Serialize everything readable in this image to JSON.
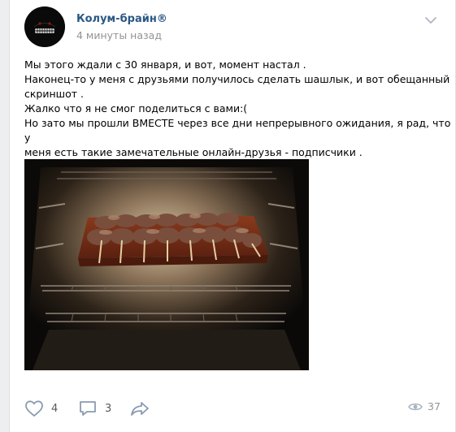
{
  "post": {
    "author": "Колум-брайн®",
    "time": "4 минуты назад",
    "text_lines": [
      "Мы этого ждали с 30 января, и вот, момент настал .",
      "Наконец-то у меня с друзьями получилось сделать шашлык, и вот обещанный",
      "скриншот .",
      "Жалко что я не смог поделиться с вами:(",
      "Но зато мы прошли ВМЕСТЕ через все дни непрерывного ожидания, я рад, что у",
      "меня есть такие замечательные онлайн-друзья - подписчики ."
    ]
  },
  "actions": {
    "likes": "4",
    "comments": "3",
    "views": "37"
  },
  "icons": {
    "like": "heart-icon",
    "comment": "comment-icon",
    "share": "share-arrow-icon",
    "views": "eye-icon",
    "menu": "chevron-down-icon"
  },
  "colors": {
    "author_link": "#2a5885",
    "meta_gray": "#939393",
    "icon_gray": "#8a9bb0"
  }
}
